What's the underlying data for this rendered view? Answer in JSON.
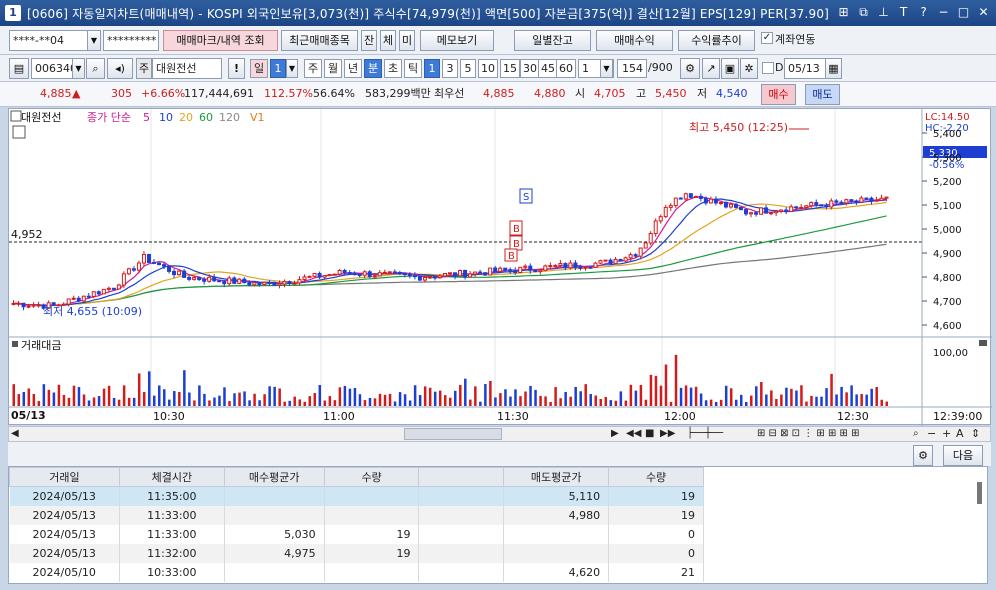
{
  "window": {
    "title": "[0606] 자동일지차트(매매내역) - KOSPI 외국인보유[3,073(천)] 주식수[74,979(천)] 액면[500] 자본금[375(억)] 결산[12월] EPS[129] PER[37.90]",
    "app_badge": "1"
  },
  "toolbar1": {
    "account": "****-**04",
    "password": "*********",
    "trade_mark_btn": "매매마크/내역 조회",
    "recent_btn": "최근매매종목",
    "chk_jan": "잔",
    "chk_che": "체",
    "chk_mi": "미",
    "memo_btn": "메모보기",
    "daily_balance_btn": "일별잔고",
    "trade_profit_btn": "매매수익",
    "profit_trend_btn": "수익률추이",
    "account_link_label": "계좌연동"
  },
  "toolbar2": {
    "code": "006340",
    "stock_name": "대원전선",
    "stock_type": "주",
    "period_day": "일",
    "period_day_num": "1",
    "periods": [
      "주",
      "월",
      "년",
      "분",
      "초",
      "틱"
    ],
    "intervals": [
      "1",
      "3",
      "5",
      "10",
      "15",
      "30",
      "45",
      "60"
    ],
    "interval_count": "1",
    "data_count": "154",
    "data_total": "/900",
    "check_d": "D",
    "date": "05/13"
  },
  "quote": {
    "price": "4,885",
    "arrow": "▲",
    "change": "305",
    "change_pct": "+6.66%",
    "volume": "117,444,691",
    "vol_ratio": "112.57%",
    "turnover": "56.64%",
    "amount": "583,299백만",
    "best_label": "최우선",
    "best_ask": "4,885",
    "best_bid": "4,880",
    "open_label": "시",
    "open": "4,705",
    "high_label": "고",
    "high": "5,450",
    "low_label": "저",
    "low": "4,540",
    "buy_btn": "매수",
    "sell_btn": "매도"
  },
  "chart": {
    "name": "대원전선",
    "ma_label": "종가 단순",
    "ma_periods": [
      "5",
      "10",
      "20",
      "60",
      "120"
    ],
    "v_label": "V1",
    "lc": "LC:14.50",
    "hc": "HC:-2.20",
    "high_annot": "최고 5,450 (12:25)",
    "low_annot": "최저 4,655 (10:09)",
    "ref_price": "4,952",
    "cur_price": "5,330",
    "cur_pct": "-0.56%",
    "y_ticks": [
      "5,400",
      "5,300",
      "5,200",
      "5,100",
      "5,000",
      "4,900",
      "4,800",
      "4,700",
      "4,600"
    ],
    "vol_title": "거래대금",
    "vol_tick": "100,00",
    "date_label": "05/13",
    "x_ticks": [
      "10:30",
      "11:00",
      "11:30",
      "12:00",
      "12:30",
      "12:39:00"
    ],
    "marks": [
      "S",
      "B",
      "B",
      "B"
    ]
  },
  "chart_data": {
    "type": "candlestick",
    "ref_line": 4952,
    "high": 5450,
    "low": 4655,
    "last": 5330
  },
  "table": {
    "headers": [
      "거래일",
      "체결시간",
      "매수평균가",
      "수량",
      "",
      "매도평균가",
      "수량"
    ],
    "rows": [
      [
        "2024/05/13",
        "11:35:00",
        "",
        "",
        "",
        "5,110",
        "19"
      ],
      [
        "2024/05/13",
        "11:33:00",
        "",
        "",
        "",
        "4,980",
        "19"
      ],
      [
        "2024/05/13",
        "11:33:00",
        "5,030",
        "19",
        "",
        "",
        "0"
      ],
      [
        "2024/05/13",
        "11:32:00",
        "4,975",
        "19",
        "",
        "",
        "0"
      ],
      [
        "2024/05/10",
        "10:33:00",
        "",
        "",
        "",
        "4,620",
        "21"
      ]
    ],
    "next_btn": "다음"
  }
}
